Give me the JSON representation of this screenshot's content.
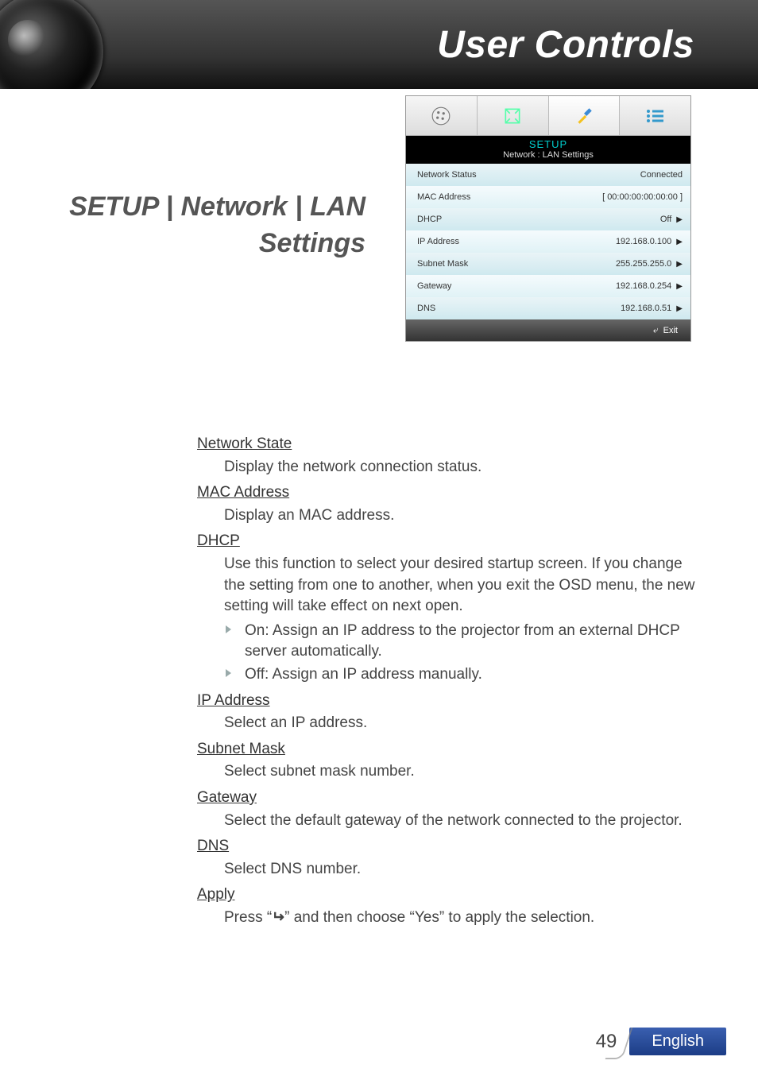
{
  "header": {
    "title": "User Controls"
  },
  "section_heading": "SETUP | Network | LAN Settings",
  "osd": {
    "title1": "SETUP",
    "title2": "Network : LAN Settings",
    "rows": [
      {
        "label": "Network Status",
        "value": "Connected",
        "arrow": false
      },
      {
        "label": "MAC Address",
        "value": "[ 00:00:00:00:00:00 ]",
        "arrow": false
      },
      {
        "label": "DHCP",
        "value": "Off",
        "arrow": true
      },
      {
        "label": "IP Address",
        "value": "192.168.0.100",
        "arrow": true
      },
      {
        "label": "Subnet Mask",
        "value": "255.255.255.0",
        "arrow": true
      },
      {
        "label": "Gateway",
        "value": "192.168.0.254",
        "arrow": true
      },
      {
        "label": "DNS",
        "value": "192.168.0.51",
        "arrow": true
      }
    ],
    "exit": "Exit"
  },
  "body": {
    "items": [
      {
        "h": "Network State",
        "p": [
          "Display the network connection status."
        ]
      },
      {
        "h": "MAC Address",
        "p": [
          "Display an MAC address."
        ]
      },
      {
        "h": "DHCP",
        "p": [
          "Use this function to select your desired startup screen. If you change the setting from one to another, when you exit the OSD menu, the new setting will take effect on next open."
        ],
        "li": [
          "On: Assign an IP address to the projector from an external DHCP server automatically.",
          "Off: Assign an IP address manually."
        ]
      },
      {
        "h": "IP Address",
        "p": [
          "Select an IP address."
        ]
      },
      {
        "h": "Subnet Mask",
        "p": [
          "Select subnet mask number."
        ]
      },
      {
        "h": "Gateway",
        "p": [
          "Select the default gateway of the network connected to the projector."
        ]
      },
      {
        "h": "DNS",
        "p": [
          "Select DNS number."
        ]
      },
      {
        "h": "Apply",
        "p_html": "apply"
      }
    ],
    "apply_prefix": "Press “",
    "apply_suffix": "” and then choose “Yes” to apply the selection."
  },
  "footer": {
    "page": "49",
    "language": "English"
  }
}
